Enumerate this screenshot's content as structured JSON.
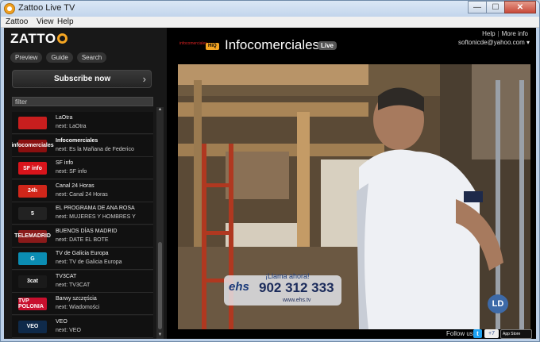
{
  "window": {
    "title": "Zattoo Live TV",
    "min": "—",
    "max": "☐",
    "close": "✕"
  },
  "menu": [
    "Zattoo",
    "View",
    "Help"
  ],
  "brand": {
    "logo": "ZATTO"
  },
  "nav_tabs": [
    "Preview",
    "Guide",
    "Search"
  ],
  "subscribe": {
    "label": "Subscribe now",
    "chevron": "›"
  },
  "filter": {
    "value": "filter"
  },
  "channels": [
    {
      "logo": "",
      "logo_color": "#c81e1e",
      "name": "LaOtra",
      "next": "next: LaOtra",
      "active": false
    },
    {
      "logo": "infocomerciales",
      "logo_color": "#8a1010",
      "name": "Infocomerciales",
      "next": "next: Es la Mañana de Federico",
      "active": true
    },
    {
      "logo": "SF info",
      "logo_color": "#d9141b",
      "name": "SF info",
      "next": "next: SF info",
      "active": false
    },
    {
      "logo": "24h",
      "logo_color": "#d0261a",
      "name": "Canal 24 Horas",
      "next": "next: Canal 24 Horas",
      "active": false
    },
    {
      "logo": "5",
      "logo_color": "#222222",
      "name": "EL PROGRAMA DE ANA ROSA",
      "next": "next: MUJERES Y HOMBRES Y",
      "active": false
    },
    {
      "logo": "TELEMADRID",
      "logo_color": "#8a1a1a",
      "name": "BUENOS DÍAS MADRID",
      "next": "next: DATE EL BOTE",
      "active": false
    },
    {
      "logo": "G",
      "logo_color": "#0b8db3",
      "name": "TV de Galicia Europa",
      "next": "next: TV de Galicia Europa",
      "active": false
    },
    {
      "logo": "3cat",
      "logo_color": "#1a1a1a",
      "name": "TV3CAT",
      "next": "next: TV3CAT",
      "active": false
    },
    {
      "logo": "TVP POLONIA",
      "logo_color": "#c8102e",
      "name": "Barwy szczęścia",
      "next": "next: Wiadomości",
      "active": false
    },
    {
      "logo": "VEO",
      "logo_color": "#0f2a4a",
      "name": "VEO",
      "next": "next: VEO",
      "active": false
    }
  ],
  "player": {
    "quality": "HiQ",
    "channel_title": "Infocomerciales",
    "live": "Live",
    "tiny_logo": "infocomerciales",
    "links": [
      "Help",
      "More info"
    ],
    "account": "softonicde@yahoo.com ▾",
    "overlay": {
      "tagline": "¡Llama ahora!",
      "brand": "ehs",
      "phone": "902 312 333",
      "url": "www.ehs.tv",
      "corner": "LD"
    }
  },
  "footer": {
    "follow": "Follow us",
    "twitter": "t",
    "facebook": "+7",
    "appstore": "App Store"
  }
}
